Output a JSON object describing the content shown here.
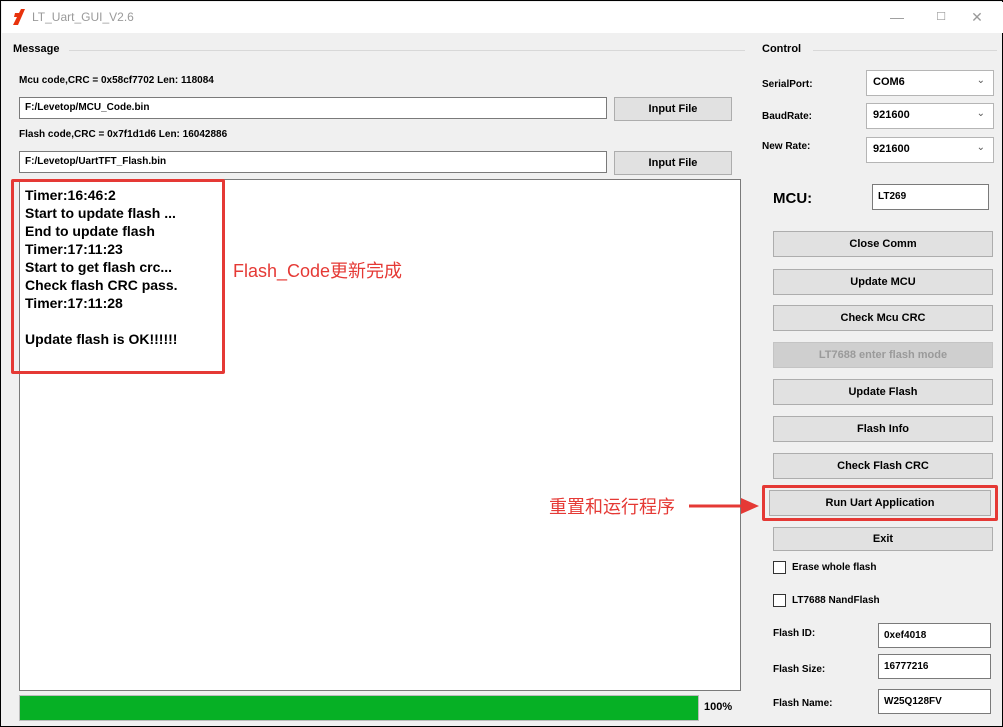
{
  "window": {
    "title": "LT_Uart_GUI_V2.6",
    "minimize": "—",
    "maximize": "☐",
    "close": "✕"
  },
  "message": {
    "section_label": "Message",
    "mcu_code_info": "Mcu code,CRC = 0x58cf7702  Len: 118084",
    "mcu_path": "F:/Levetop/MCU_Code.bin",
    "input_file_1": "Input File",
    "flash_code_info": "Flash code,CRC = 0x7f1d1d6  Len: 16042886",
    "flash_path": "F:/Levetop/UartTFT_Flash.bin",
    "input_file_2": "Input File",
    "log_lines": [
      "Timer:16:46:2",
      "Start to update flash ...",
      "End to update flash",
      "Timer:17:11:23",
      "Start to get flash crc...",
      "Check flash CRC pass.",
      "Timer:17:11:28",
      "",
      "Update flash is OK!!!!!!"
    ],
    "progress_value": 1.0,
    "progress_text": "100%"
  },
  "annotations": {
    "flash_done": "Flash_Code更新完成",
    "reset_run": "重置和运行程序",
    "color": "#e53935"
  },
  "control": {
    "section_label": "Control",
    "serial_port_label": "SerialPort:",
    "serial_port_value": "COM6",
    "baud_rate_label": "BaudRate:",
    "baud_rate_value": "921600",
    "new_rate_label": "New Rate:",
    "new_rate_value": "921600",
    "mcu_label": "MCU:",
    "mcu_value": "LT269",
    "buttons": {
      "close_comm": "Close Comm",
      "update_mcu": "Update MCU",
      "check_mcu_crc": "Check Mcu CRC",
      "lt7688_flash_mode": "LT7688 enter flash mode",
      "update_flash": "Update Flash",
      "flash_info": "Flash Info",
      "check_flash_crc": "Check Flash CRC",
      "run_uart_app": "Run Uart Application",
      "exit": "Exit"
    },
    "erase_whole_flash": "Erase whole flash",
    "lt7688_nandflash": "LT7688 NandFlash",
    "flash_id_label": "Flash ID:",
    "flash_id_value": "0xef4018",
    "flash_size_label": "Flash Size:",
    "flash_size_value": "16777216",
    "flash_name_label": "Flash Name:",
    "flash_name_value": "W25Q128FV"
  }
}
